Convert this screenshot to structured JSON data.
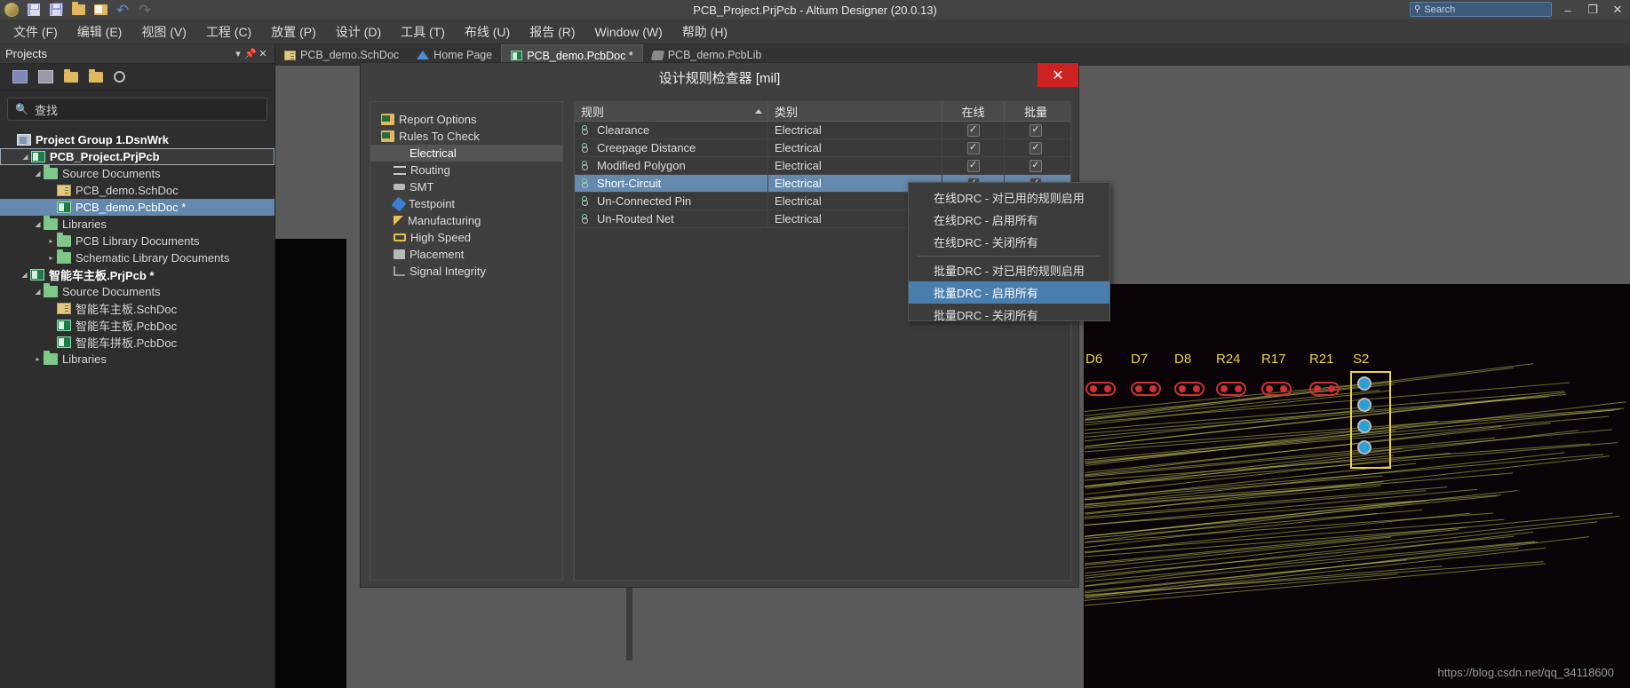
{
  "window": {
    "title": "PCB_Project.PrjPcb - Altium Designer (20.0.13)",
    "minimize": "–",
    "maximize": "❐",
    "close": "✕"
  },
  "search": {
    "placeholder": "Search",
    "icon": "search-icon",
    "glyph": "⚲"
  },
  "toolbar": {
    "items": [
      {
        "name": "altium-logo-icon",
        "label": ""
      },
      {
        "name": "save-icon",
        "label": ""
      },
      {
        "name": "save-all-icon",
        "label": ""
      },
      {
        "name": "open-folder-icon",
        "label": ""
      },
      {
        "name": "open-document-icon",
        "label": ""
      },
      {
        "name": "undo-icon",
        "glyph": "↶"
      },
      {
        "name": "redo-icon",
        "glyph": "↷"
      }
    ]
  },
  "menubar": {
    "items": [
      "文件 (F)",
      "编辑 (E)",
      "视图 (V)",
      "工程 (C)",
      "放置 (P)",
      "设计 (D)",
      "工具 (T)",
      "布线 (U)",
      "报告 (R)",
      "Window (W)",
      "帮助 (H)"
    ]
  },
  "tabs": [
    {
      "label": "PCB_demo.SchDoc",
      "icon": "schematic-doc-icon",
      "active": false
    },
    {
      "label": "Home Page",
      "icon": "home-icon",
      "active": false
    },
    {
      "label": "PCB_demo.PcbDoc *",
      "icon": "pcb-doc-icon",
      "active": true
    },
    {
      "label": "PCB_demo.PcbLib",
      "icon": "pcb-lib-icon",
      "active": false
    }
  ],
  "projects_panel": {
    "title": "Projects",
    "header_buttons": [
      "▾",
      "⚖",
      "✕"
    ],
    "toolbar_icons": [
      "save-icon",
      "document-icon",
      "open-folder-icon",
      "open-project-icon",
      "settings-gear-icon"
    ],
    "search": {
      "value": "查找",
      "icon": "search-icon"
    },
    "tree": [
      {
        "label": "Project Group 1.DsnWrk",
        "indent": 0,
        "icon": "workspace-icon",
        "arrow": "",
        "bold": true,
        "state": ""
      },
      {
        "label": "PCB_Project.PrjPcb",
        "indent": 1,
        "icon": "project-icon",
        "arrow": "◢",
        "bold": true,
        "state": "outline"
      },
      {
        "label": "Source Documents",
        "indent": 2,
        "icon": "folder-icon",
        "arrow": "◢",
        "bold": false,
        "state": ""
      },
      {
        "label": "PCB_demo.SchDoc",
        "indent": 3,
        "icon": "schematic-doc-icon",
        "arrow": "",
        "bold": false,
        "state": ""
      },
      {
        "label": "PCB_demo.PcbDoc *",
        "indent": 3,
        "icon": "pcb-doc-icon",
        "arrow": "",
        "bold": false,
        "state": "selected"
      },
      {
        "label": "Libraries",
        "indent": 2,
        "icon": "folder-icon",
        "arrow": "◢",
        "bold": false,
        "state": ""
      },
      {
        "label": "PCB Library Documents",
        "indent": 3,
        "icon": "folder-icon",
        "arrow": "▸",
        "bold": false,
        "state": ""
      },
      {
        "label": "Schematic Library Documents",
        "indent": 3,
        "icon": "folder-icon",
        "arrow": "▸",
        "bold": false,
        "state": ""
      },
      {
        "label": "智能车主板.PrjPcb *",
        "indent": 1,
        "icon": "project-icon",
        "arrow": "◢",
        "bold": true,
        "state": ""
      },
      {
        "label": "Source Documents",
        "indent": 2,
        "icon": "folder-icon",
        "arrow": "◢",
        "bold": false,
        "state": ""
      },
      {
        "label": "智能车主板.SchDoc",
        "indent": 3,
        "icon": "schematic-doc-icon",
        "arrow": "",
        "bold": false,
        "state": ""
      },
      {
        "label": "智能车主板.PcbDoc",
        "indent": 3,
        "icon": "pcb-doc-icon",
        "arrow": "",
        "bold": false,
        "state": ""
      },
      {
        "label": "智能车拼板.PcbDoc",
        "indent": 3,
        "icon": "pcb-doc-icon",
        "arrow": "",
        "bold": false,
        "state": ""
      },
      {
        "label": "Libraries",
        "indent": 2,
        "icon": "folder-icon",
        "arrow": "▸",
        "bold": false,
        "state": ""
      }
    ]
  },
  "drc_dialog": {
    "title": "设计规则检查器 [mil]",
    "close_label": "✕",
    "nav": [
      {
        "label": "Report Options",
        "icon": "report-options-icon",
        "indent": 0,
        "active": false
      },
      {
        "label": "Rules To Check",
        "icon": "rules-to-check-icon",
        "indent": 0,
        "active": false
      },
      {
        "label": "Electrical",
        "icon": "electrical-icon",
        "indent": 1,
        "active": true
      },
      {
        "label": "Routing",
        "icon": "routing-icon",
        "indent": 1,
        "active": false
      },
      {
        "label": "SMT",
        "icon": "smt-icon",
        "indent": 1,
        "active": false
      },
      {
        "label": "Testpoint",
        "icon": "testpoint-icon",
        "indent": 1,
        "active": false
      },
      {
        "label": "Manufacturing",
        "icon": "manufacturing-icon",
        "indent": 1,
        "active": false
      },
      {
        "label": "High Speed",
        "icon": "high-speed-icon",
        "indent": 1,
        "active": false
      },
      {
        "label": "Placement",
        "icon": "placement-icon",
        "indent": 1,
        "active": false
      },
      {
        "label": "Signal Integrity",
        "icon": "signal-integrity-icon",
        "indent": 1,
        "active": false
      }
    ],
    "table": {
      "columns": [
        "规则",
        "类别",
        "在线",
        "批量"
      ],
      "sorted_column": 0,
      "rows": [
        {
          "rule": "Clearance",
          "category": "Electrical",
          "online": true,
          "batch": true,
          "selected": false
        },
        {
          "rule": "Creepage Distance",
          "category": "Electrical",
          "online": true,
          "batch": true,
          "selected": false
        },
        {
          "rule": "Modified Polygon",
          "category": "Electrical",
          "online": true,
          "batch": true,
          "selected": false
        },
        {
          "rule": "Short-Circuit",
          "category": "Electrical",
          "online": true,
          "batch": true,
          "selected": true
        },
        {
          "rule": "Un-Connected Pin",
          "category": "Electrical",
          "online": false,
          "batch": false,
          "selected": false
        },
        {
          "rule": "Un-Routed Net",
          "category": "Electrical",
          "online": false,
          "batch": false,
          "selected": false
        }
      ],
      "check_glyph": "✓"
    }
  },
  "context_menu": {
    "items": [
      {
        "label": "在线DRC - 对已用的规则启用",
        "highlighted": false,
        "separator_after": false
      },
      {
        "label": "在线DRC - 启用所有",
        "highlighted": false,
        "separator_after": false
      },
      {
        "label": "在线DRC - 关闭所有",
        "highlighted": false,
        "separator_after": true
      },
      {
        "label": "批量DRC - 对已用的规则启用",
        "highlighted": false,
        "separator_after": false
      },
      {
        "label": "批量DRC - 启用所有",
        "highlighted": true,
        "separator_after": false
      },
      {
        "label": "批量DRC - 关闭所有",
        "highlighted": false,
        "separator_after": false
      }
    ]
  },
  "canvas": {
    "component_labels": [
      "D6",
      "D7",
      "D8",
      "R24",
      "R17",
      "R21",
      "S2"
    ],
    "watermark": "https://blog.csdn.net/qq_34118600"
  }
}
